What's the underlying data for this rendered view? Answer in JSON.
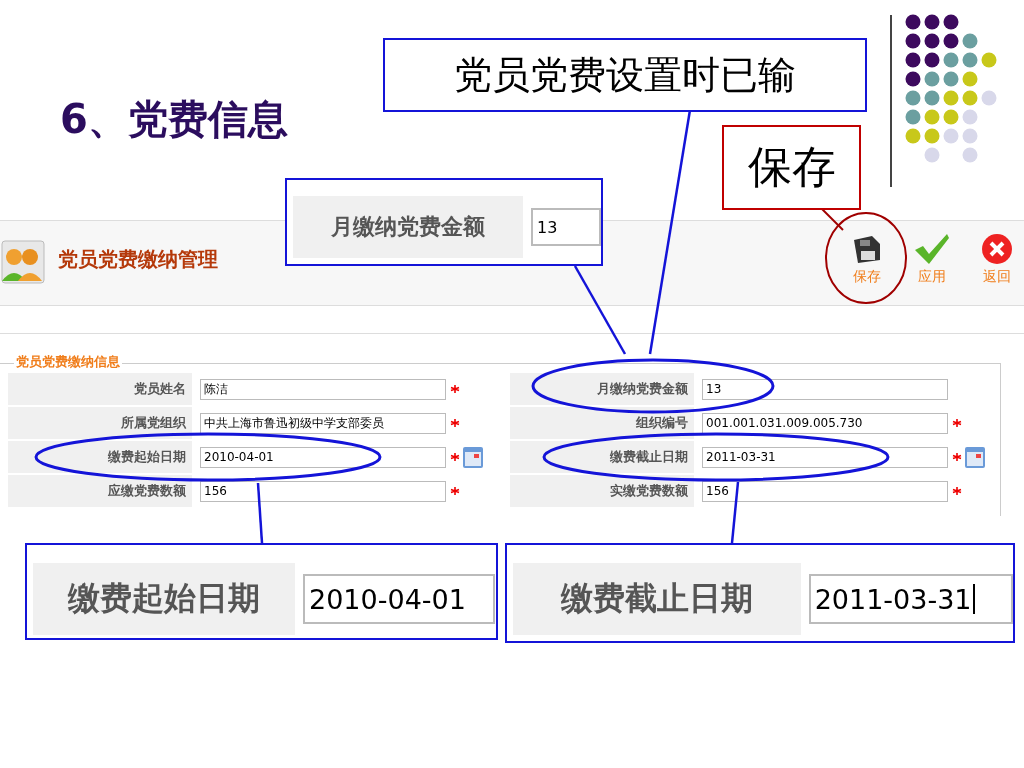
{
  "slide": {
    "title": "6、党费信息"
  },
  "callouts": [
    {
      "kind": "note",
      "text": "党员党费设置时已输"
    },
    {
      "kind": "button",
      "text": "保存"
    }
  ],
  "app": {
    "title": "党员党费缴纳管理",
    "toolbar": [
      {
        "kind": "save",
        "label": "保存"
      },
      {
        "kind": "apply",
        "label": "应用"
      },
      {
        "kind": "back",
        "label": "返回"
      }
    ],
    "section": "党员党费缴纳信息",
    "columns": [
      [
        {
          "label": "党员姓名",
          "value": "陈洁",
          "required": true,
          "calendar": false,
          "circled": false
        },
        {
          "label": "所属党组织",
          "value": "中共上海市鲁迅初级中学支部委员",
          "required": true,
          "calendar": false,
          "circled": false
        },
        {
          "label": "缴费起始日期",
          "value": "2010-04-01",
          "required": true,
          "calendar": true,
          "circled": true
        },
        {
          "label": "应缴党费数额",
          "value": "156",
          "required": true,
          "calendar": false,
          "circled": false
        }
      ],
      [
        {
          "label": "月缴纳党费金额",
          "value": "13",
          "required": false,
          "calendar": false,
          "circled": true
        },
        {
          "label": "组织编号",
          "value": "001.001.031.009.005.730",
          "required": true,
          "calendar": false,
          "circled": false
        },
        {
          "label": "缴费截止日期",
          "value": "2011-03-31",
          "required": true,
          "calendar": true,
          "circled": true
        },
        {
          "label": "实缴党费数额",
          "value": "156",
          "required": true,
          "calendar": false,
          "circled": false
        }
      ]
    ]
  },
  "zooms": [
    {
      "label": "月缴纳党费金额",
      "value": "13",
      "cursor": false
    },
    {
      "label": "缴费起始日期",
      "value": "2010-04-01",
      "cursor": false
    },
    {
      "label": "缴费截止日期",
      "value": "2011-03-31",
      "cursor": true
    }
  ]
}
